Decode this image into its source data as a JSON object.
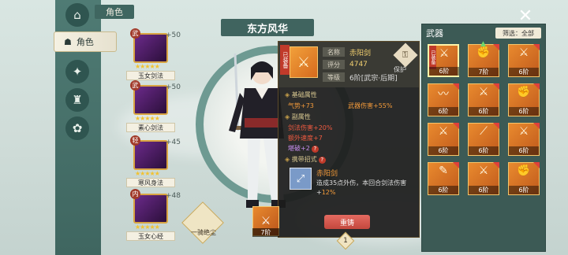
{
  "section_tag": "角色",
  "nav": {
    "active_label": "角色"
  },
  "skills": [
    {
      "name": "玉女剑法",
      "level": "+50",
      "badge": "武"
    },
    {
      "name": "素心剑法",
      "level": "+50",
      "badge": "武"
    },
    {
      "name": "寒风身法",
      "level": "+45",
      "badge": "轻"
    },
    {
      "name": "玉女心经",
      "level": "+48",
      "badge": "内"
    }
  ],
  "character": {
    "name": "东方风华"
  },
  "xinfa": {
    "label": "一骑绝尘"
  },
  "tooltip": {
    "equipped": "已装备",
    "name_label": "名称",
    "name": "赤阳剑",
    "score_label": "评分",
    "score": "4747",
    "grade_label": "等级",
    "grade": "6阶[武宗·后期]",
    "lock_label": "保护",
    "base_title": "基础属性",
    "base_attr_1": "气势+73",
    "base_attr_2": "武器伤害+55%",
    "sub_title": "副属性",
    "sub_attr_1": "剑法伤害+20%",
    "sub_attr_2": "额外速度+7",
    "sub_attr_3": "堪破+2",
    "move_title": "携带招式",
    "move_name": "赤阳剑",
    "move_desc": "造成35点外伤，本回合剑法伤害+",
    "move_desc_bonus": "12%",
    "refine_button": "重铸"
  },
  "bottom_weapon": {
    "level": "7阶"
  },
  "page_number": "1",
  "weapons_panel": {
    "title": "武器",
    "filter": "筛选：全部",
    "items": [
      {
        "level": "6阶",
        "equipped": "已装备"
      },
      {
        "level": "7阶"
      },
      {
        "level": "6阶"
      },
      {
        "level": "6阶"
      },
      {
        "level": "6阶"
      },
      {
        "level": "6阶"
      },
      {
        "level": "6阶"
      },
      {
        "level": "6阶"
      },
      {
        "level": "6阶"
      },
      {
        "level": "6阶"
      },
      {
        "level": "6阶"
      },
      {
        "level": "6阶"
      }
    ]
  }
}
